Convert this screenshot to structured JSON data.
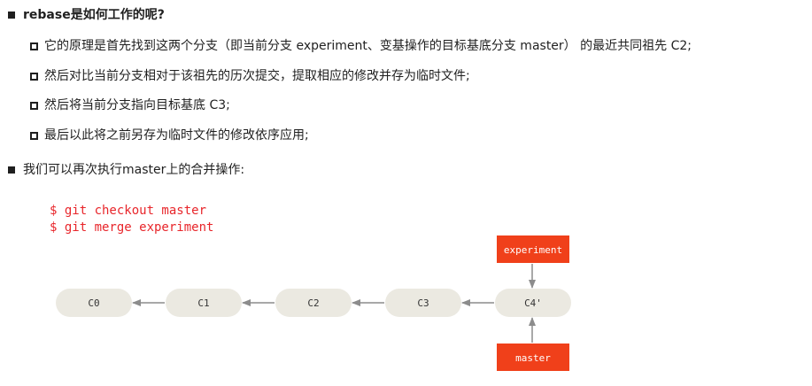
{
  "heading": "rebase是如何工作的呢?",
  "sub_items": [
    "它的原理是首先找到这两个分支（即当前分支 experiment、变基操作的目标基底分支 master） 的最近共同祖先 C2;",
    "然后对比当前分支相对于该祖先的历次提交，提取相应的修改并存为临时文件;",
    "然后将当前分支指向目标基底 C3;",
    "最后以此将之前另存为临时文件的修改依序应用;"
  ],
  "second_bullet": "我们可以再次执行master上的合并操作:",
  "code_lines": [
    "$ git checkout master",
    "$ git merge experiment"
  ],
  "diagram": {
    "commits": [
      "C0",
      "C1",
      "C2",
      "C3",
      "C4'"
    ],
    "branch_top": "experiment",
    "branch_bottom": "master",
    "colors": {
      "commit_fill": "#ebe9e1",
      "ref_fill": "#f0401a",
      "arrow": "#8c8c8c",
      "code": "#e8262b"
    }
  }
}
